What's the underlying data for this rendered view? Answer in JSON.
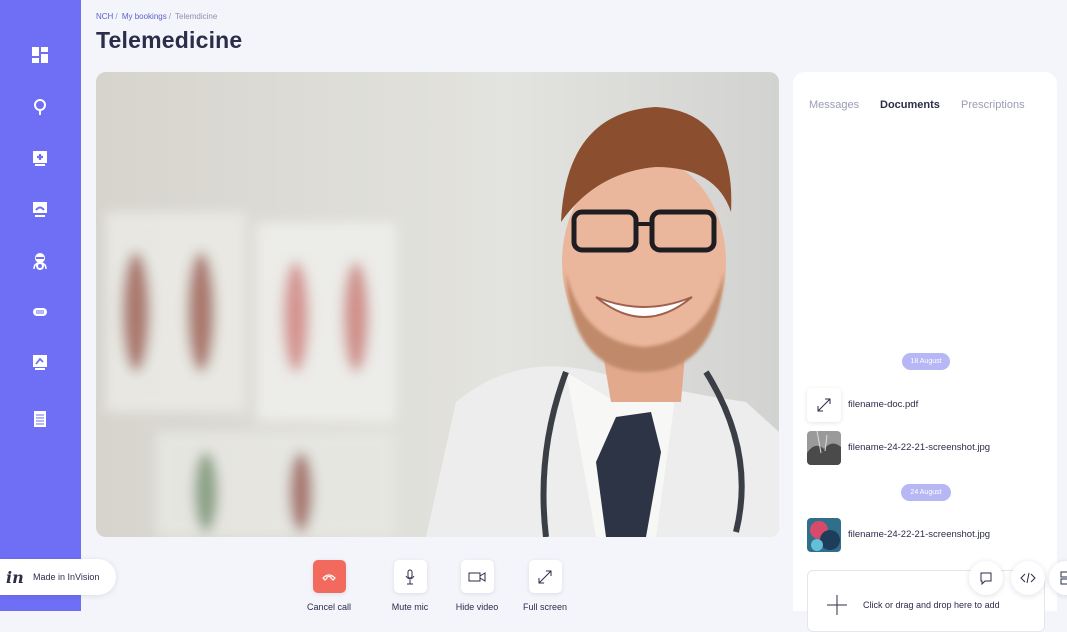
{
  "breadcrumb": {
    "root": "NCH",
    "separator": "/",
    "section": "My bookings",
    "current": "Telemdicine"
  },
  "page": {
    "title": "Telemedicine"
  },
  "sidebar": {
    "icons": [
      "dashboard-icon",
      "location-pin-icon",
      "medical-kit-icon",
      "monitor-icon",
      "doctor-icon",
      "chat-icon",
      "prescription-icon",
      "document-icon"
    ]
  },
  "controls": {
    "cancel_call": "Cancel call",
    "mute_mic": "Mute mic",
    "hide_video": "Hide video",
    "full_screen": "Full screen"
  },
  "panel": {
    "tabs": [
      {
        "label": "Messages",
        "active": false
      },
      {
        "label": "Documents",
        "active": true
      },
      {
        "label": "Prescriptions",
        "active": false
      }
    ],
    "groups": [
      {
        "date": "18 August",
        "files": [
          {
            "name": "filename-doc.pdf",
            "thumb": "expand-icon"
          },
          {
            "name": "filename-24-22-21-screenshot.jpg",
            "thumb": "image-thumbnail"
          }
        ]
      },
      {
        "date": "24 August",
        "files": [
          {
            "name": "filename-24-22-21-screenshot.jpg",
            "thumb": "image-thumbnail"
          }
        ]
      }
    ],
    "dropzone_text": "Click or drag and drop here to add"
  },
  "invision": {
    "logo": "in",
    "text": "Made in InVision"
  },
  "colors": {
    "sidebar": "#6e6ff5",
    "cancel_call": "#f26a5d",
    "date_pill": "#b6b7f4"
  }
}
